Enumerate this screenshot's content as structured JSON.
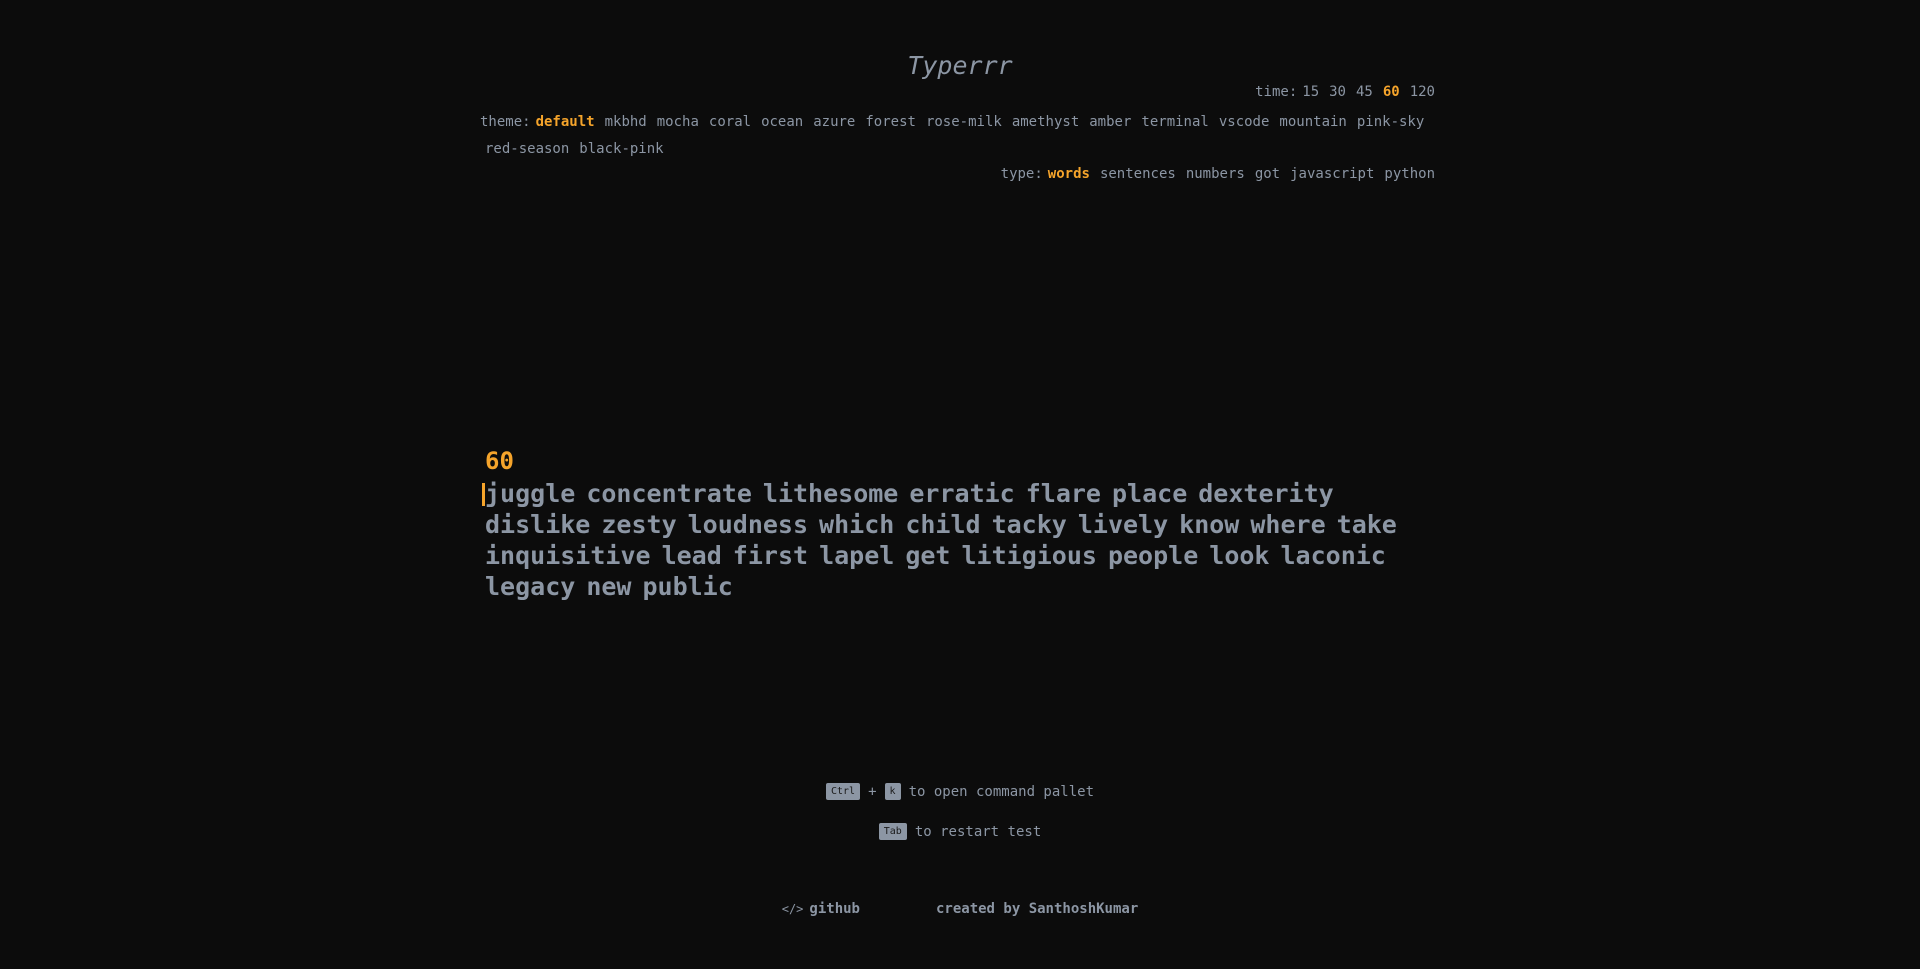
{
  "app": {
    "title": "Typerrr"
  },
  "time": {
    "label": "time:",
    "options": [
      "15",
      "30",
      "45",
      "60",
      "120"
    ],
    "selected": "60"
  },
  "theme": {
    "label": "theme:",
    "options": [
      "default",
      "mkbhd",
      "mocha",
      "coral",
      "ocean",
      "azure",
      "forest",
      "rose-milk",
      "amethyst",
      "amber",
      "terminal",
      "vscode",
      "mountain",
      "pink-sky",
      "red-season",
      "black-pink"
    ],
    "selected": "default"
  },
  "type": {
    "label": "type:",
    "options": [
      "words",
      "sentences",
      "numbers",
      "got",
      "javascript",
      "python"
    ],
    "selected": "words"
  },
  "test": {
    "countdown": "60",
    "words": [
      "juggle",
      "concentrate",
      "lithesome",
      "erratic",
      "flare",
      "place",
      "dexterity",
      "dislike",
      "zesty",
      "loudness",
      "which",
      "child",
      "tacky",
      "lively",
      "know",
      "where",
      "take",
      "inquisitive",
      "lead",
      "first",
      "lapel",
      "get",
      "litigious",
      "people",
      "look",
      "laconic",
      "legacy",
      "new",
      "public"
    ]
  },
  "hints": {
    "ctrl_key": "Ctrl",
    "plus": "+",
    "k_key": "k",
    "command_text": "to open command pallet",
    "tab_key": "Tab",
    "restart_text": "to restart test"
  },
  "footer": {
    "code_icon": "</>",
    "github_label": "github",
    "credit": "created by SanthoshKumar"
  },
  "colors": {
    "background": "#0c0c0c",
    "text": "#8c96a4",
    "accent": "#f5a42b"
  }
}
